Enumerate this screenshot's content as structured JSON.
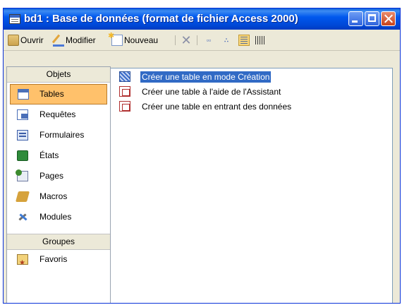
{
  "window": {
    "title": "bd1 : Base de données (format de fichier Access 2000)"
  },
  "toolbar": {
    "open_label": "Ouvrir",
    "modify_label": "Modifier",
    "new_label": "Nouveau"
  },
  "objects_panel": {
    "header": "Objets",
    "items": [
      {
        "label": "Tables",
        "icon": "table-icon",
        "selected": true
      },
      {
        "label": "Requêtes",
        "icon": "query-icon"
      },
      {
        "label": "Formulaires",
        "icon": "form-icon"
      },
      {
        "label": "États",
        "icon": "report-icon"
      },
      {
        "label": "Pages",
        "icon": "page-icon"
      },
      {
        "label": "Macros",
        "icon": "macro-icon"
      },
      {
        "label": "Modules",
        "icon": "module-icon"
      }
    ],
    "groups_header": "Groupes",
    "groups": [
      {
        "label": "Favoris",
        "icon": "favorites-icon"
      }
    ]
  },
  "list": {
    "items": [
      {
        "label": "Créer une table en mode Création",
        "icon": "design-view-icon",
        "selected": true
      },
      {
        "label": "Créer une table à l'aide de l'Assistant",
        "icon": "wizard-icon"
      },
      {
        "label": "Créer une table en entrant des données",
        "icon": "datasheet-icon"
      }
    ]
  },
  "colors": {
    "titlebar": "#0058EE",
    "selection": "#316AC5",
    "selected_object": "#FFC16B",
    "window_bg": "#ECE9D8"
  }
}
